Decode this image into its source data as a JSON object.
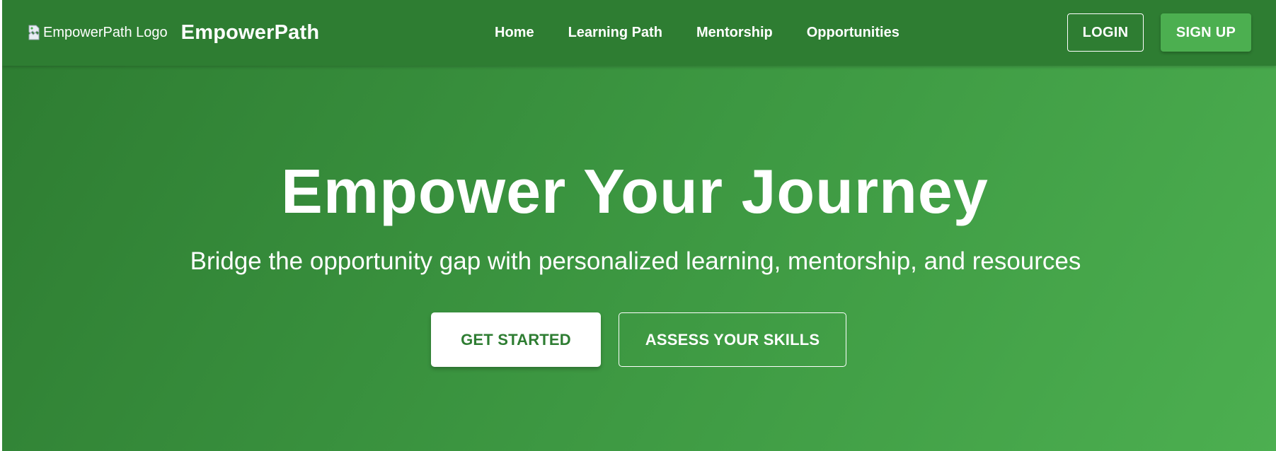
{
  "header": {
    "logo_alt": "EmpowerPath Logo",
    "brand": "EmpowerPath",
    "nav": [
      {
        "label": "Home"
      },
      {
        "label": "Learning Path"
      },
      {
        "label": "Mentorship"
      },
      {
        "label": "Opportunities"
      }
    ],
    "login_label": "LOGIN",
    "signup_label": "SIGN UP"
  },
  "hero": {
    "title": "Empower Your Journey",
    "subtitle": "Bridge the opportunity gap with personalized learning, mentorship, and resources",
    "primary_button": "GET STARTED",
    "secondary_button": "ASSESS YOUR SKILLS"
  },
  "colors": {
    "primary_dark": "#2e7d32",
    "primary": "#4caf50",
    "text_on_primary": "#ffffff"
  },
  "icons": {
    "logo_placeholder": "broken-image-icon"
  }
}
